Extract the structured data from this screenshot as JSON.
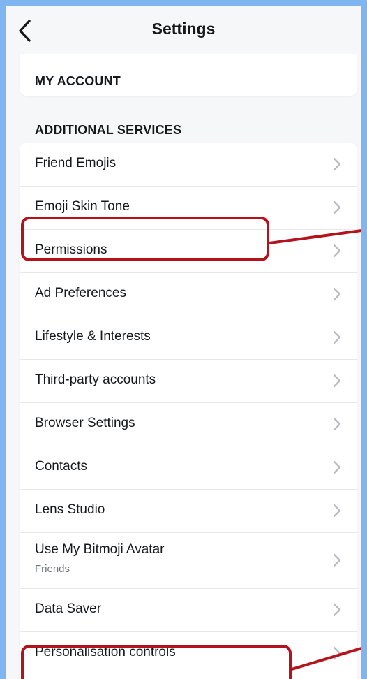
{
  "header": {
    "title": "Settings",
    "back_icon": "chevron-left-icon"
  },
  "sections": {
    "my_account": "MY ACCOUNT",
    "additional_services": "ADDITIONAL SERVICES"
  },
  "items": [
    {
      "label": "Friend Emojis"
    },
    {
      "label": "Emoji Skin Tone"
    },
    {
      "label": "Permissions"
    },
    {
      "label": "Ad Preferences"
    },
    {
      "label": "Lifestyle & Interests"
    },
    {
      "label": "Third-party accounts"
    },
    {
      "label": "Browser Settings"
    },
    {
      "label": "Contacts"
    },
    {
      "label": "Lens Studio"
    },
    {
      "label": "Use My Bitmoji Avatar",
      "sub": "Friends"
    },
    {
      "label": "Data Saver"
    },
    {
      "label": "Personalisation controls"
    }
  ],
  "colors": {
    "page_background": "#7fb6ef",
    "surface": "#f6f7f8",
    "highlight": "#b4131b",
    "chevron": "#b9bdc2"
  }
}
